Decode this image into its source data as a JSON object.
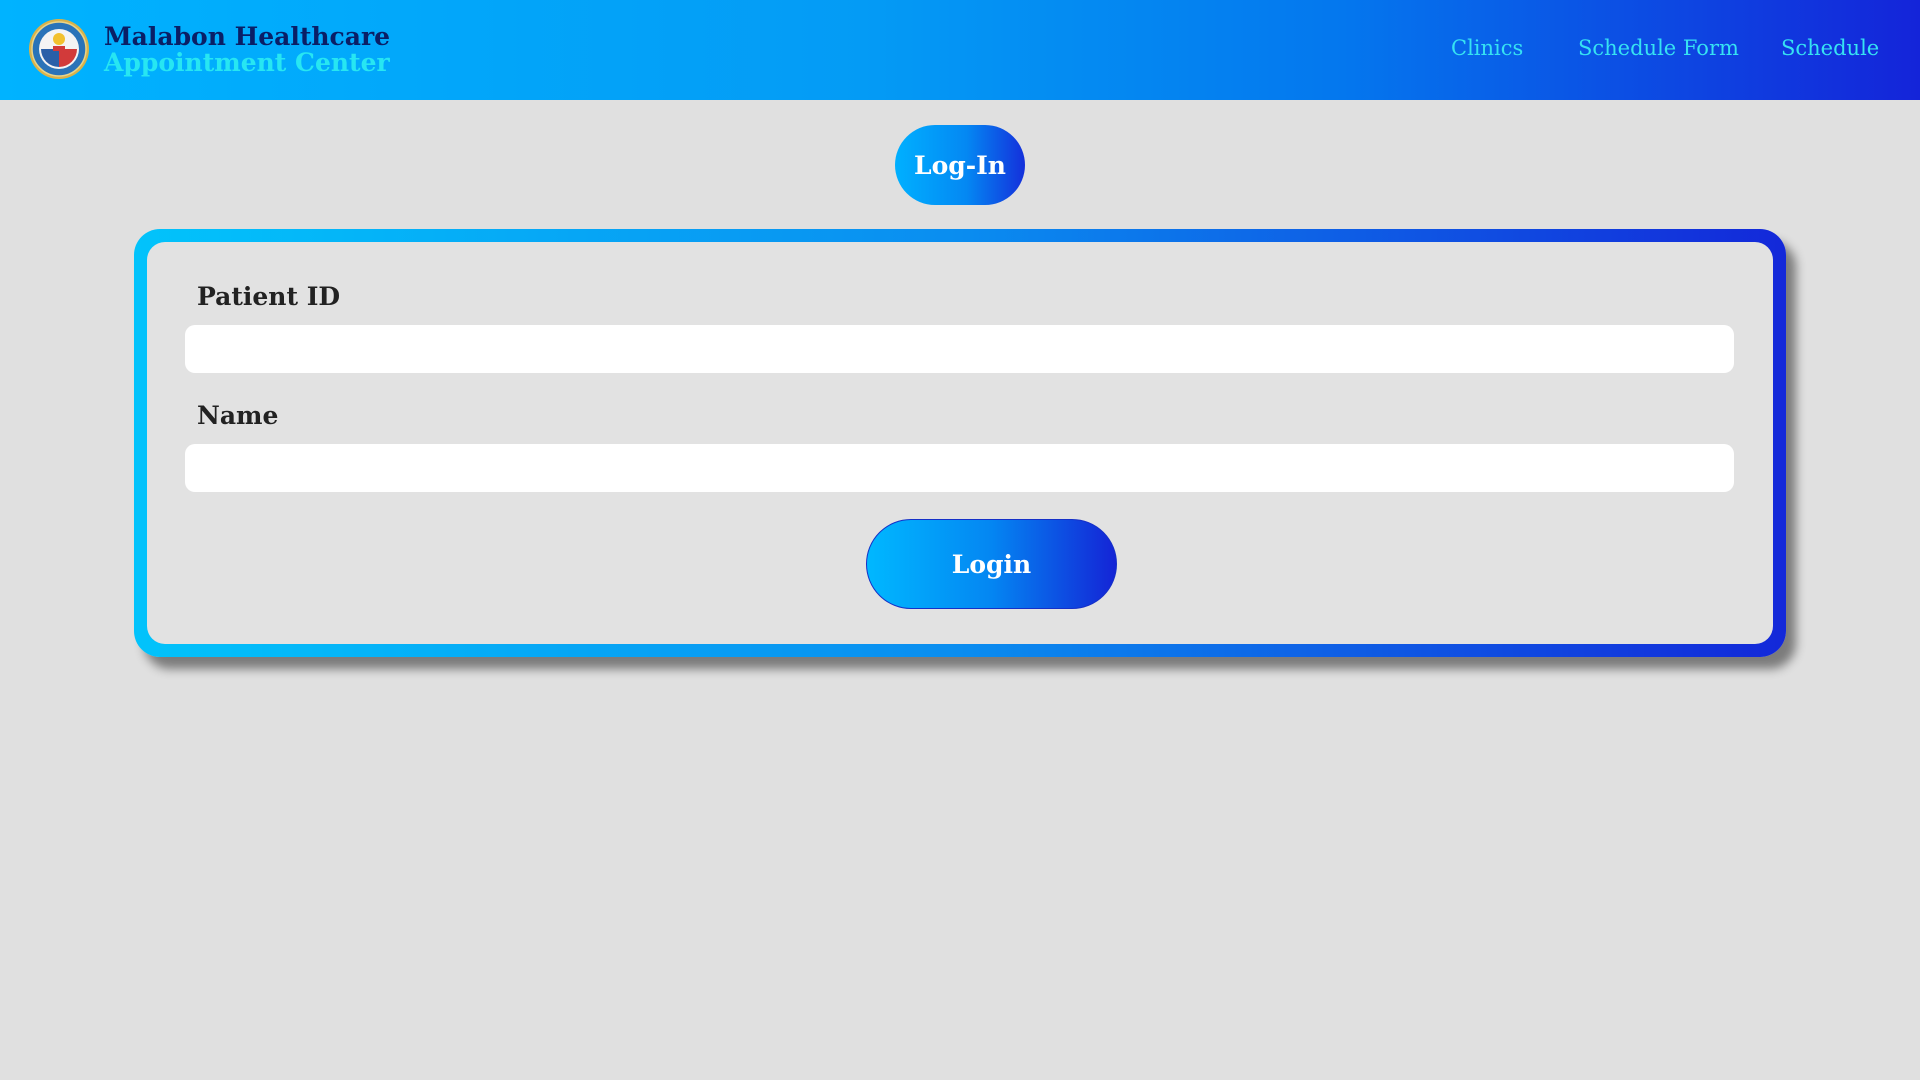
{
  "header": {
    "brand_title": "Malabon Healthcare",
    "brand_subtitle": "Appointment Center",
    "logo_icon": "city-seal-logo",
    "nav": [
      {
        "label": "Clinics"
      },
      {
        "label": "Schedule Form"
      },
      {
        "label": "Schedule"
      }
    ]
  },
  "page": {
    "section_badge": "Log-In"
  },
  "form": {
    "patient_id_label": "Patient ID",
    "patient_id_value": "",
    "name_label": "Name",
    "name_value": "",
    "submit_label": "Login"
  },
  "colors": {
    "page_background": "#e0e0e0",
    "gradient_start": "#00b3ff",
    "gradient_end": "#1424d9",
    "brand_title": "#0a1f66",
    "brand_subtitle": "#27e6f2",
    "nav_link": "#36e2f2",
    "label_text": "#222222"
  }
}
